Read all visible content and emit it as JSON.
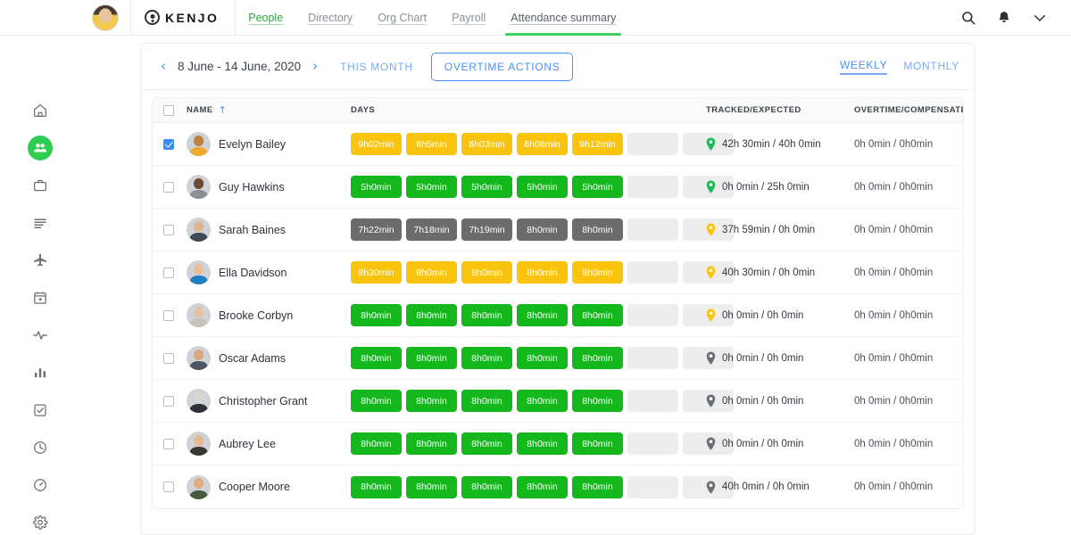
{
  "topbar": {
    "brand": "KENJO",
    "nav": [
      {
        "label": "People",
        "state": "active-green"
      },
      {
        "label": "Directory",
        "state": "normal"
      },
      {
        "label": "Org Chart",
        "state": "normal"
      },
      {
        "label": "Payroll",
        "state": "normal"
      },
      {
        "label": "Attendance summary",
        "state": "selected"
      }
    ],
    "icons": [
      "search-icon",
      "bell-icon",
      "chevron-down-icon"
    ]
  },
  "sidebar": {
    "items": [
      {
        "name": "home-icon",
        "active": false
      },
      {
        "name": "people-icon",
        "active": true
      },
      {
        "name": "briefcase-icon",
        "active": false
      },
      {
        "name": "list-icon",
        "active": false
      },
      {
        "name": "airplane-icon",
        "active": false
      },
      {
        "name": "calendar-icon",
        "active": false
      },
      {
        "name": "activity-icon",
        "active": false
      },
      {
        "name": "bar-chart-icon",
        "active": false
      },
      {
        "name": "checklist-icon",
        "active": false
      },
      {
        "name": "clock-icon",
        "active": false
      },
      {
        "name": "speedometer-icon",
        "active": false
      },
      {
        "name": "gear-icon",
        "active": false
      }
    ]
  },
  "toolbar": {
    "prev_arrow": "‹",
    "next_arrow": "›",
    "date_range": "8 June - 14 June, 2020",
    "this_month": "THIS MONTH",
    "overtime_actions": "OVERTIME ACTIONS",
    "weekly": "WEEKLY",
    "monthly": "MONTHLY",
    "active_period": "WEEKLY"
  },
  "table": {
    "headers": {
      "name": "NAME",
      "sort_arrow": "↑",
      "days": "DAYS",
      "tracked": "TRACKED/EXPECTED",
      "overtime": "OVERTIME/COMPENSATED"
    },
    "select_all_checked": false,
    "rows": [
      {
        "name": "Evelyn Bailey",
        "checked": true,
        "skin": "#c1803f",
        "cloth": "#f0a830",
        "days": [
          {
            "label": "9h02min",
            "kind": "amber"
          },
          {
            "label": "8h5min",
            "kind": "amber"
          },
          {
            "label": "8h03min",
            "kind": "amber"
          },
          {
            "label": "8h08min",
            "kind": "amber"
          },
          {
            "label": "9h12min",
            "kind": "amber"
          },
          {
            "label": "",
            "kind": "empty"
          },
          {
            "label": "",
            "kind": "empty"
          }
        ],
        "pin_color": "#1db954",
        "tracked": "42h 30min / 40h 0min",
        "overtime": "0h 0min / 0h0min"
      },
      {
        "name": "Guy Hawkins",
        "checked": false,
        "skin": "#6b4a33",
        "cloth": "#8a8f96",
        "days": [
          {
            "label": "5h0min",
            "kind": "green"
          },
          {
            "label": "5h0min",
            "kind": "green"
          },
          {
            "label": "5h0min",
            "kind": "green"
          },
          {
            "label": "5h0min",
            "kind": "green"
          },
          {
            "label": "5h0min",
            "kind": "green"
          },
          {
            "label": "",
            "kind": "empty"
          },
          {
            "label": "",
            "kind": "empty"
          }
        ],
        "pin_color": "#1db954",
        "tracked": "0h 0min / 25h 0min",
        "overtime": "0h 0min / 0h0min"
      },
      {
        "name": "Sarah Baines",
        "checked": false,
        "skin": "#e0b48e",
        "cloth": "#3f4a57",
        "days": [
          {
            "label": "7h22min",
            "kind": "gray"
          },
          {
            "label": "7h18min",
            "kind": "gray"
          },
          {
            "label": "7h19min",
            "kind": "gray"
          },
          {
            "label": "8h0min",
            "kind": "gray"
          },
          {
            "label": "8h0min",
            "kind": "gray"
          },
          {
            "label": "",
            "kind": "empty"
          },
          {
            "label": "",
            "kind": "empty"
          }
        ],
        "pin_color": "#fac40e",
        "tracked": "37h 59min / 0h 0min",
        "overtime": "0h 0min / 0h0min"
      },
      {
        "name": "Ella Davidson",
        "checked": false,
        "skin": "#e7bf9a",
        "cloth": "#1f7ec4",
        "days": [
          {
            "label": "8h30min",
            "kind": "amber"
          },
          {
            "label": "8h0min",
            "kind": "amber"
          },
          {
            "label": "8h0min",
            "kind": "amber"
          },
          {
            "label": "8h0min",
            "kind": "amber"
          },
          {
            "label": "8h0min",
            "kind": "amber"
          },
          {
            "label": "",
            "kind": "empty"
          },
          {
            "label": "",
            "kind": "empty"
          }
        ],
        "pin_color": "#fac40e",
        "tracked": "40h 30min / 0h 0min",
        "overtime": "0h 0min / 0h0min"
      },
      {
        "name": "Brooke Corbyn",
        "checked": false,
        "skin": "#e8c0a2",
        "cloth": "#c9c2bb",
        "days": [
          {
            "label": "8h0min",
            "kind": "green"
          },
          {
            "label": "8h0min",
            "kind": "green"
          },
          {
            "label": "8h0min",
            "kind": "green"
          },
          {
            "label": "8h0min",
            "kind": "green"
          },
          {
            "label": "8h0min",
            "kind": "green"
          },
          {
            "label": "",
            "kind": "empty"
          },
          {
            "label": "",
            "kind": "empty"
          }
        ],
        "pin_color": "#fac40e",
        "tracked": "0h 0min / 0h 0min",
        "overtime": "0h 0min / 0h0min"
      },
      {
        "name": "Oscar Adams",
        "checked": false,
        "skin": "#d9a87e",
        "cloth": "#4d5663",
        "days": [
          {
            "label": "8h0min",
            "kind": "green"
          },
          {
            "label": "8h0min",
            "kind": "green"
          },
          {
            "label": "8h0min",
            "kind": "green"
          },
          {
            "label": "8h0min",
            "kind": "green"
          },
          {
            "label": "8h0min",
            "kind": "green"
          },
          {
            "label": "",
            "kind": "empty"
          },
          {
            "label": "",
            "kind": "empty"
          }
        ],
        "pin_color": "#6b6f76",
        "tracked": "0h 0min / 0h 0min",
        "overtime": "0h 0min / 0h0min"
      },
      {
        "name": "Christopher Grant",
        "checked": false,
        "skin": "#d8d6d2",
        "cloth": "#2e3238",
        "days": [
          {
            "label": "8h0min",
            "kind": "green"
          },
          {
            "label": "8h0min",
            "kind": "green"
          },
          {
            "label": "8h0min",
            "kind": "green"
          },
          {
            "label": "8h0min",
            "kind": "green"
          },
          {
            "label": "8h0min",
            "kind": "green"
          },
          {
            "label": "",
            "kind": "empty"
          },
          {
            "label": "",
            "kind": "empty"
          }
        ],
        "pin_color": "#6b6f76",
        "tracked": "0h 0min / 0h 0min",
        "overtime": "0h 0min / 0h0min"
      },
      {
        "name": "Aubrey Lee",
        "checked": false,
        "skin": "#e4b98f",
        "cloth": "#3a3632",
        "days": [
          {
            "label": "8h0min",
            "kind": "green"
          },
          {
            "label": "8h0min",
            "kind": "green"
          },
          {
            "label": "8h0min",
            "kind": "green"
          },
          {
            "label": "8h0min",
            "kind": "green"
          },
          {
            "label": "8h0min",
            "kind": "green"
          },
          {
            "label": "",
            "kind": "empty"
          },
          {
            "label": "",
            "kind": "empty"
          }
        ],
        "pin_color": "#6b6f76",
        "tracked": "0h 0min / 0h 0min",
        "overtime": "0h 0min / 0h0min"
      },
      {
        "name": "Cooper Moore",
        "checked": false,
        "skin": "#e0ab7f",
        "cloth": "#4a5a3c",
        "days": [
          {
            "label": "8h0min",
            "kind": "green"
          },
          {
            "label": "8h0min",
            "kind": "green"
          },
          {
            "label": "8h0min",
            "kind": "green"
          },
          {
            "label": "8h0min",
            "kind": "green"
          },
          {
            "label": "8h0min",
            "kind": "green"
          },
          {
            "label": "",
            "kind": "empty"
          },
          {
            "label": "",
            "kind": "empty"
          }
        ],
        "pin_color": "#6b6f76",
        "tracked": "40h 0min / 0h 0min",
        "overtime": "0h 0min / 0h0min"
      }
    ]
  },
  "colors": {
    "green_chip": "#14b81d",
    "amber_chip": "#fac40e",
    "gray_chip": "#6b6b6b",
    "empty_chip": "#ededed",
    "accent_blue": "#4a90f4",
    "accent_green": "#2fcc52"
  }
}
